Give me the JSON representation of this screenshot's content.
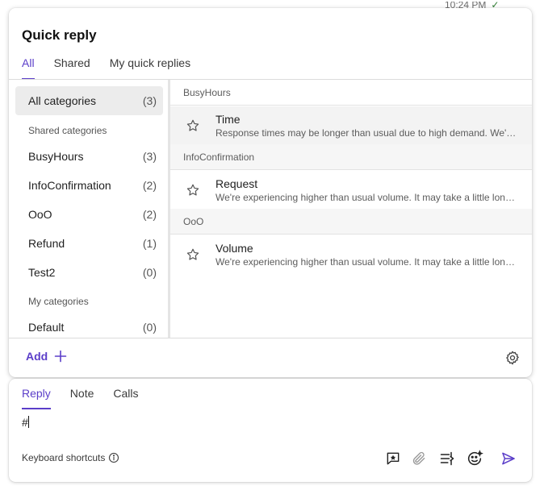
{
  "timestamp": "10:24 PM",
  "colors": {
    "accent": "#5b3ec9",
    "selected_bg": "#ececec",
    "divider": "#dcdcdc"
  },
  "quick_reply": {
    "title": "Quick reply",
    "tabs": [
      {
        "label": "All",
        "active": true
      },
      {
        "label": "Shared",
        "active": false
      },
      {
        "label": "My quick replies",
        "active": false
      }
    ],
    "categories": {
      "all": {
        "label": "All categories",
        "count": "(3)"
      },
      "shared_header": "Shared categories",
      "shared": [
        {
          "label": "BusyHours",
          "count": "(3)"
        },
        {
          "label": "InfoConfirmation",
          "count": "(2)"
        },
        {
          "label": "OoO",
          "count": "(2)"
        },
        {
          "label": "Refund",
          "count": "(1)"
        },
        {
          "label": "Test2",
          "count": "(0)"
        }
      ],
      "my_header": "My categories",
      "my": [
        {
          "label": "Default",
          "count": "(0)"
        }
      ]
    },
    "groups": [
      {
        "name": "BusyHours",
        "items": [
          {
            "title": "Time",
            "description": "Response times may be longer than usual due to high demand. We'll get back to you as soon as possible.",
            "icon": "star-icon"
          }
        ]
      },
      {
        "name": "InfoConfirmation",
        "items": [
          {
            "title": "Request",
            "description": "We're experiencing higher than usual volume. It may take a little longer to respond.",
            "icon": "star-icon"
          }
        ]
      },
      {
        "name": "OoO",
        "items": [
          {
            "title": "Volume",
            "description": "We're experiencing higher than usual volume. It may take a little longer to respond.",
            "icon": "star-icon"
          }
        ]
      }
    ],
    "footer": {
      "add_label": "Add",
      "add_icon": "plus-icon",
      "settings_icon": "gear-icon"
    }
  },
  "composer": {
    "tabs": [
      {
        "label": "Reply",
        "active": true
      },
      {
        "label": "Note",
        "active": false
      },
      {
        "label": "Calls",
        "active": false
      }
    ],
    "input_value": "#",
    "keyboard_shortcuts_label": "Keyboard shortcuts",
    "toolbar_icons": [
      "quick-reply-icon",
      "attachment-icon",
      "macro-icon",
      "ai-assist-icon",
      "send-icon"
    ]
  }
}
